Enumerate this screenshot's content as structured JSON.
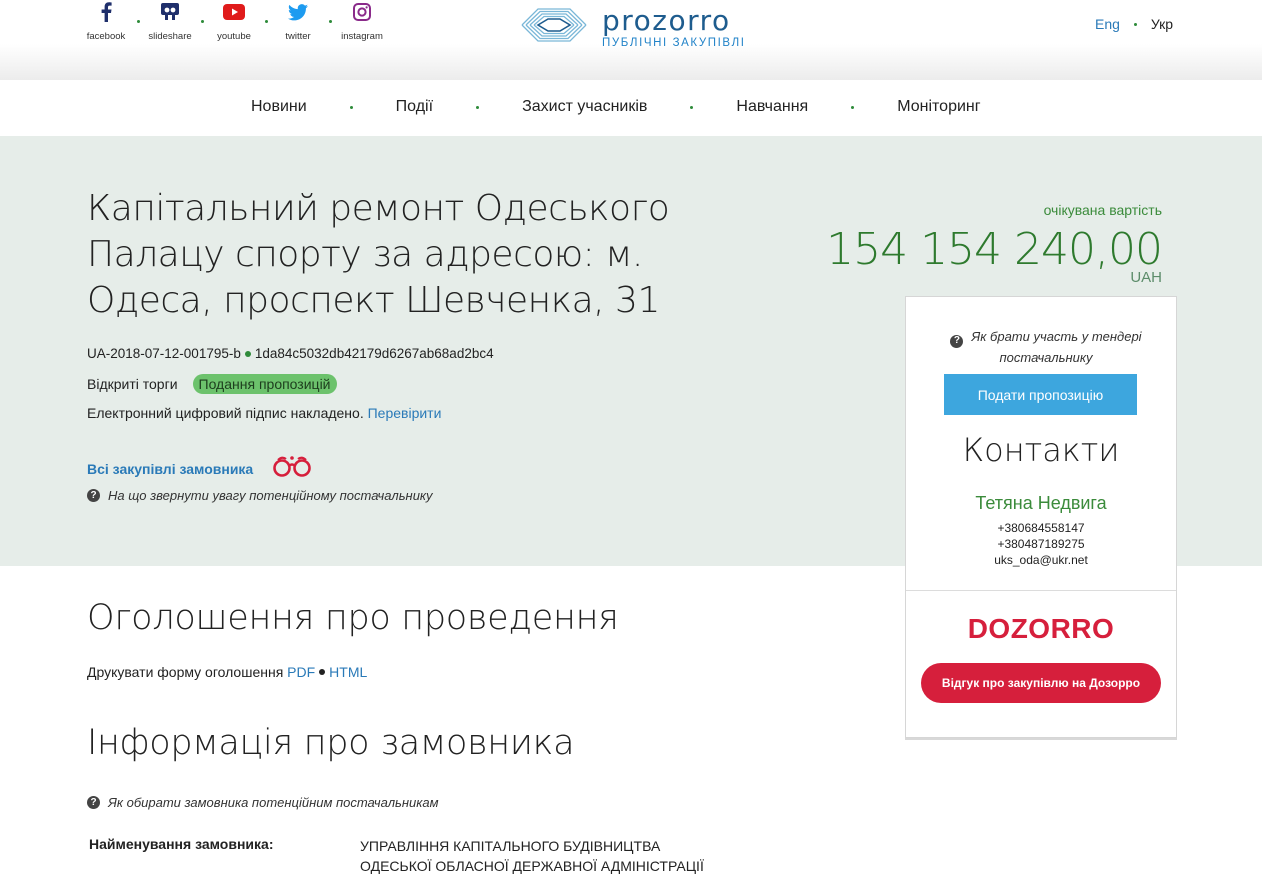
{
  "header": {
    "socials": [
      {
        "label": "facebook",
        "icon": "facebook-icon"
      },
      {
        "label": "slideshare",
        "icon": "slideshare-icon"
      },
      {
        "label": "youtube",
        "icon": "youtube-icon"
      },
      {
        "label": "twitter",
        "icon": "twitter-icon"
      },
      {
        "label": "instagram",
        "icon": "instagram-icon"
      }
    ],
    "logo": {
      "name": "prozorro",
      "subtitle": "ПУБЛІЧНІ ЗАКУПІВЛІ"
    },
    "languages": {
      "eng": "Eng",
      "ukr": "Укр"
    }
  },
  "nav": {
    "items": [
      "Новини",
      "Події",
      "Захист учасників",
      "Навчання",
      "Моніторинг"
    ]
  },
  "tender": {
    "title": "Капітальний ремонт Одеського Палацу спорту за адресою: м. Одеса, проспект Шевченка, 31",
    "id": "UA-2018-07-12-001795-b",
    "hash": "1da84c5032db42179d6267ab68ad2bc4",
    "procedure": "Відкриті торги",
    "status": "Подання пропозицій",
    "signature_text": "Електронний цифровий підпис накладено.",
    "verify_link": "Перевірити",
    "all_purchases_link": "Всі закупівлі замовника",
    "attention_hint": "На що звернути увагу потенційному постачальнику"
  },
  "price": {
    "label": "очікувана вартість",
    "value": "154 154 240,00",
    "currency": "UAH"
  },
  "sidebar": {
    "howto": "Як брати участь у тендері постачальнику",
    "submit_button": "Подати пропозицію",
    "contacts_heading": "Контакти",
    "contact_name": "Тетяна Недвига",
    "phone1": "+380684558147",
    "phone2": "+380487189275",
    "email": "uks_oda@ukr.net",
    "dozorro_logo": "DOZORRO",
    "dozorro_button": "Відгук про закупівлю на Дозорро"
  },
  "announcement": {
    "heading": "Оголошення про проведення",
    "print_label": "Друкувати форму оголошення",
    "pdf_link": "PDF",
    "html_link": "HTML"
  },
  "customer": {
    "heading": "Інформація про замовника",
    "hint": "Як обирати замовника потенційним постачальникам",
    "name_label": "Найменування замовника:",
    "name_line1": "УПРАВЛІННЯ КАПІТАЛЬНОГО БУДІВНИЦТВА",
    "name_line2": "ОДЕСЬКОЇ ОБЛАСНОЇ ДЕРЖАВНОЇ АДМІНІСТРАЦІЇ"
  },
  "colors": {
    "accent_blue": "#2a7ab8",
    "price_green": "#2e7a2e",
    "hero_bg": "#e6ede9",
    "button_blue": "#3da6de",
    "dozorro_red": "#d61f3c",
    "status_green": "#6cc26c"
  }
}
